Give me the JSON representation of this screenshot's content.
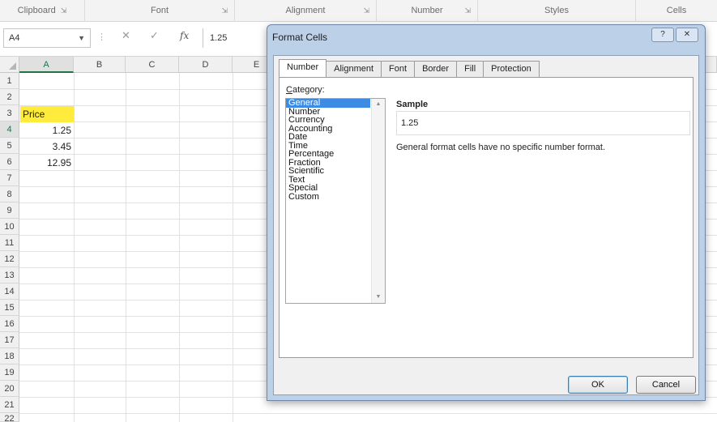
{
  "ribbon": {
    "groups": [
      {
        "label": "Clipboard",
        "launcher": "⇲"
      },
      {
        "label": "Font",
        "launcher": "⇲"
      },
      {
        "label": "Alignment",
        "launcher": "⇲"
      },
      {
        "label": "Number",
        "launcher": "⇲"
      },
      {
        "label": "Styles",
        "launcher": ""
      },
      {
        "label": "Cells",
        "launcher": ""
      }
    ]
  },
  "formula_bar": {
    "name_box": "A4",
    "cancel_icon": "✕",
    "enter_icon": "✓",
    "fx_label": "fx",
    "value": "1.25"
  },
  "sheet": {
    "columns": [
      "A",
      "B",
      "C",
      "D",
      "E"
    ],
    "rows": [
      "1",
      "2",
      "3",
      "4",
      "5",
      "6",
      "7",
      "8",
      "9",
      "10",
      "11",
      "12",
      "13",
      "14",
      "15",
      "16",
      "17",
      "18",
      "19",
      "20",
      "21",
      "22"
    ],
    "cells": {
      "A3": "Price",
      "A4": "1.25",
      "A5": "3.45",
      "A6": "12.95"
    },
    "highlight_color": "#ffeb3b"
  },
  "dialog": {
    "title": "Format Cells",
    "help_icon": "?",
    "close_icon": "✕",
    "tabs": [
      "Number",
      "Alignment",
      "Font",
      "Border",
      "Fill",
      "Protection"
    ],
    "active_tab": "Number",
    "category_label_underline": "C",
    "category_label_rest": "ategory:",
    "categories": [
      "General",
      "Number",
      "Currency",
      "Accounting",
      "Date",
      "Time",
      "Percentage",
      "Fraction",
      "Scientific",
      "Text",
      "Special",
      "Custom"
    ],
    "selected_category": "General",
    "sample_label": "Sample",
    "sample_value": "1.25",
    "description": "General format cells have no specific number format.",
    "ok_label": "OK",
    "cancel_label": "Cancel",
    "accent_color": "#3c8ce6"
  }
}
